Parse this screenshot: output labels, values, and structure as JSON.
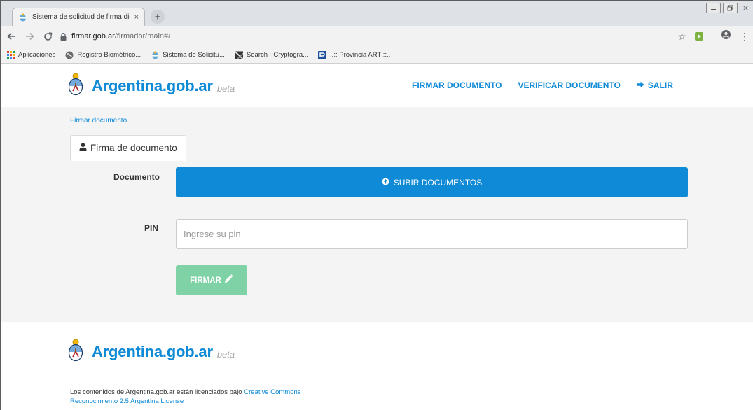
{
  "browser": {
    "tab_title": "Sistema de solicitud de firma dig",
    "tab_close": "×",
    "new_tab": "+",
    "window_controls": [
      "minimize",
      "maximize",
      "close"
    ],
    "url_host": "firmar.gob.ar",
    "url_path": "/firmador/main#/",
    "bookmarks": [
      {
        "label": "Aplicaciones",
        "icon": "apps-grid-icon"
      },
      {
        "label": "Registro Biométrico...",
        "icon": "globe-icon"
      },
      {
        "label": "Sistema de Solicitu...",
        "icon": "argentina-seal-icon"
      },
      {
        "label": "Search - Cryptogra...",
        "icon": "cryptography-icon"
      },
      {
        "label": "..:: Provincia ART ::..",
        "icon": "provincia-art-icon"
      }
    ]
  },
  "header": {
    "brand_name": "Argentina.gob.ar",
    "brand_tag": "beta",
    "nav": {
      "sign": "FIRMAR DOCUMENTO",
      "verify": "VERIFICAR DOCUMENTO",
      "exit": "SALIR"
    }
  },
  "main": {
    "breadcrumb": "Firmar documento",
    "tab_label": "Firma de documento",
    "document_label": "Documento",
    "upload_button": "SUBIR DOCUMENTOS",
    "pin_label": "PIN",
    "pin_placeholder": "Ingrese su pin",
    "pin_value": "",
    "sign_button": "FIRMAR"
  },
  "footer": {
    "brand_name": "Argentina.gob.ar",
    "brand_tag": "beta",
    "license_text": "Los contenidos de Argentina.gob.ar están licenciados bajo ",
    "license_link_1": "Creative Commons",
    "license_link_2": "Reconocimiento 2.5 Argentina License"
  },
  "colors": {
    "brand_blue": "#0f8ad6",
    "sign_button_green": "#7fd1a6",
    "content_background": "#f4f4f4"
  }
}
